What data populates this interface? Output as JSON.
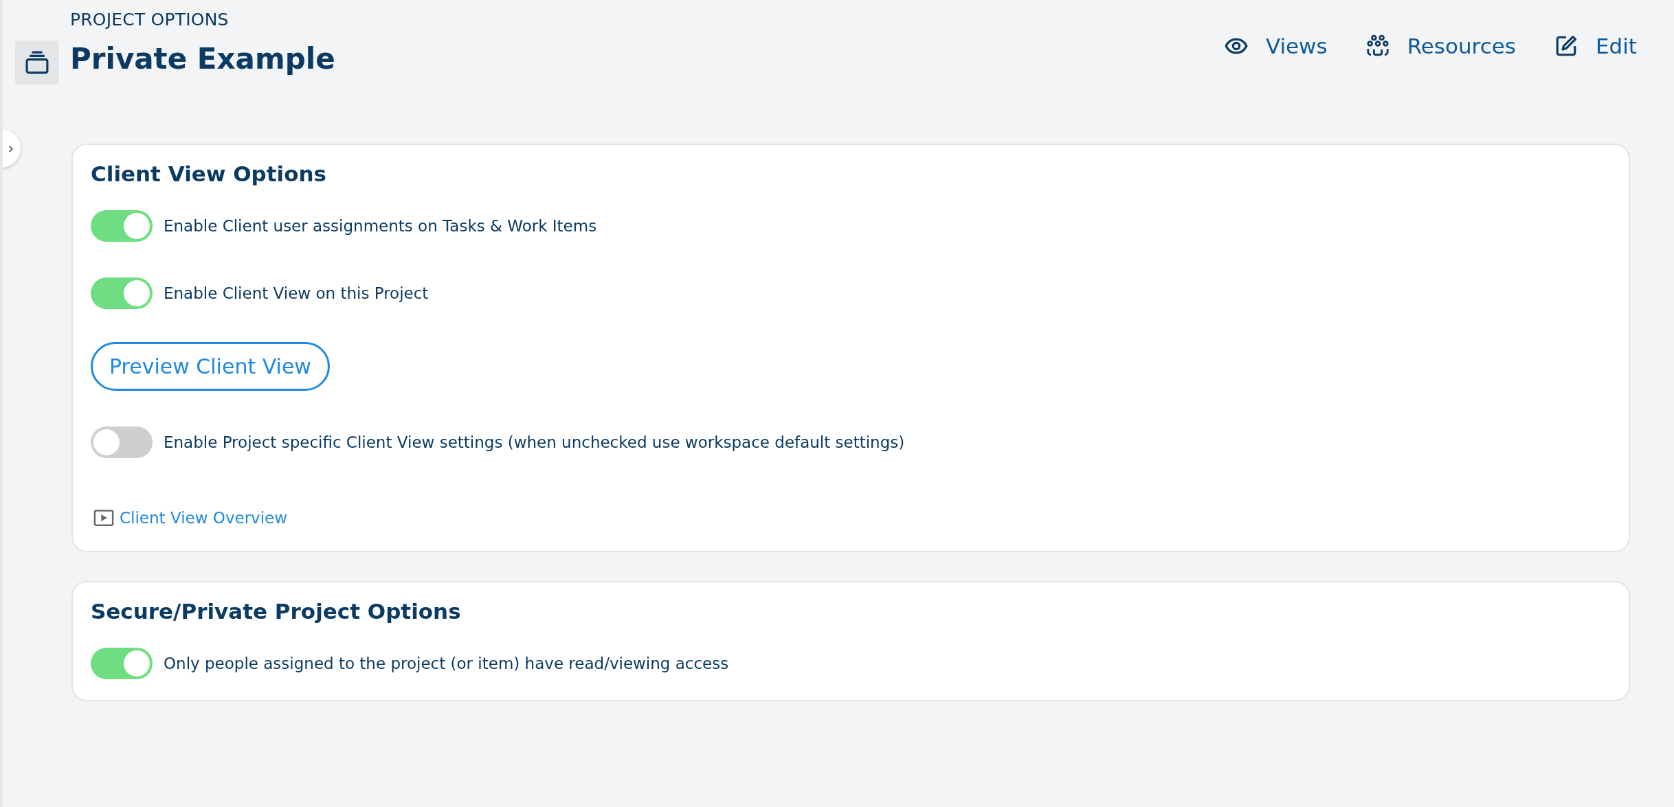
{
  "header": {
    "eyebrow": "PROJECT OPTIONS",
    "title": "Private Example"
  },
  "actions": [
    {
      "kind": "eye",
      "label": "Views"
    },
    {
      "kind": "people",
      "label": "Resources"
    },
    {
      "kind": "edit",
      "label": "Edit"
    }
  ],
  "sections": [
    {
      "title": "Client View Options",
      "items": [
        {
          "kind": "toggle",
          "label": "Enable Client user assignments on Tasks & Work Items",
          "on": true
        },
        {
          "kind": "toggle",
          "label": "Enable Client View on this Project",
          "on": true
        },
        {
          "kind": "button",
          "label": "Preview Client View"
        },
        {
          "kind": "toggle",
          "label": "Enable Project specific Client View settings (when unchecked use workspace default settings)",
          "on": false
        },
        {
          "kind": "link",
          "label": "Client View Overview"
        }
      ]
    },
    {
      "title": "Secure/Private Project Options",
      "items": [
        {
          "kind": "toggle",
          "label": "Only people assigned to the project (or item) have read/viewing access",
          "on": true
        }
      ]
    }
  ]
}
